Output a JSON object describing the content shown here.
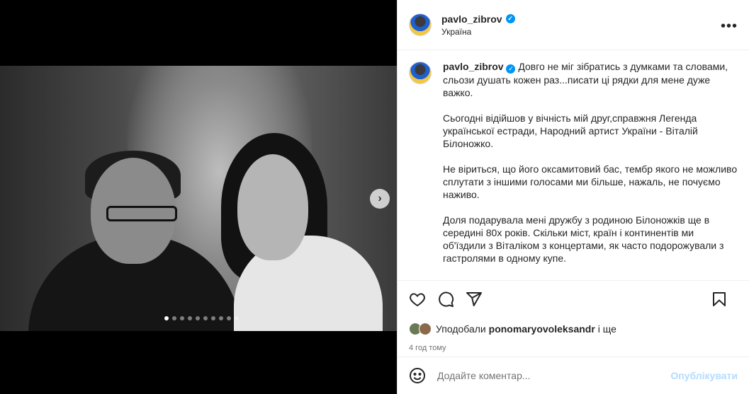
{
  "post": {
    "username": "pavlo_zibrov",
    "location": "Україна",
    "more_label": "•••",
    "verified_mark": "✓",
    "next_arrow": "›",
    "caption_paragraphs": [
      "Довго не міг зібратись з думками та словами, сльози душать кожен раз...писати ці рядки для мене дуже важко.",
      "Сьогодні відійшов у вічність мій друг,справжня Легенда української естради, Народний артист України - Віталій Білоножко.",
      "Не віриться, що його оксамитовий бас, тембр якого не можливо сплутати з іншими голосами ми більше, нажаль, не почуємо наживо.",
      "Доля подарувала мені дружбу з родиною Білоножків ще в середині 80х років. Скільки міст, країн і континентів ми об'їздили з Віталіком з концертами, як часто подорожували з гастролями в одному купе."
    ],
    "likes_prefix": "Уподобали ",
    "likes_user": "ponomaryovoleksandr",
    "likes_suffix": " і ще",
    "time_ago": "4 год тому",
    "carousel": {
      "total": 10,
      "active_index": 0
    }
  },
  "comment_box": {
    "placeholder": "Додайте коментар...",
    "publish_label": "Опублікувати"
  },
  "icons": {
    "more": "more-options-icon",
    "next": "chevron-right-icon",
    "like": "heart-icon",
    "comment": "comment-icon",
    "share": "share-icon",
    "save": "bookmark-icon",
    "emoji": "emoji-icon"
  },
  "colors": {
    "verified": "#0095f6",
    "publish_disabled": "#b3dbff"
  }
}
